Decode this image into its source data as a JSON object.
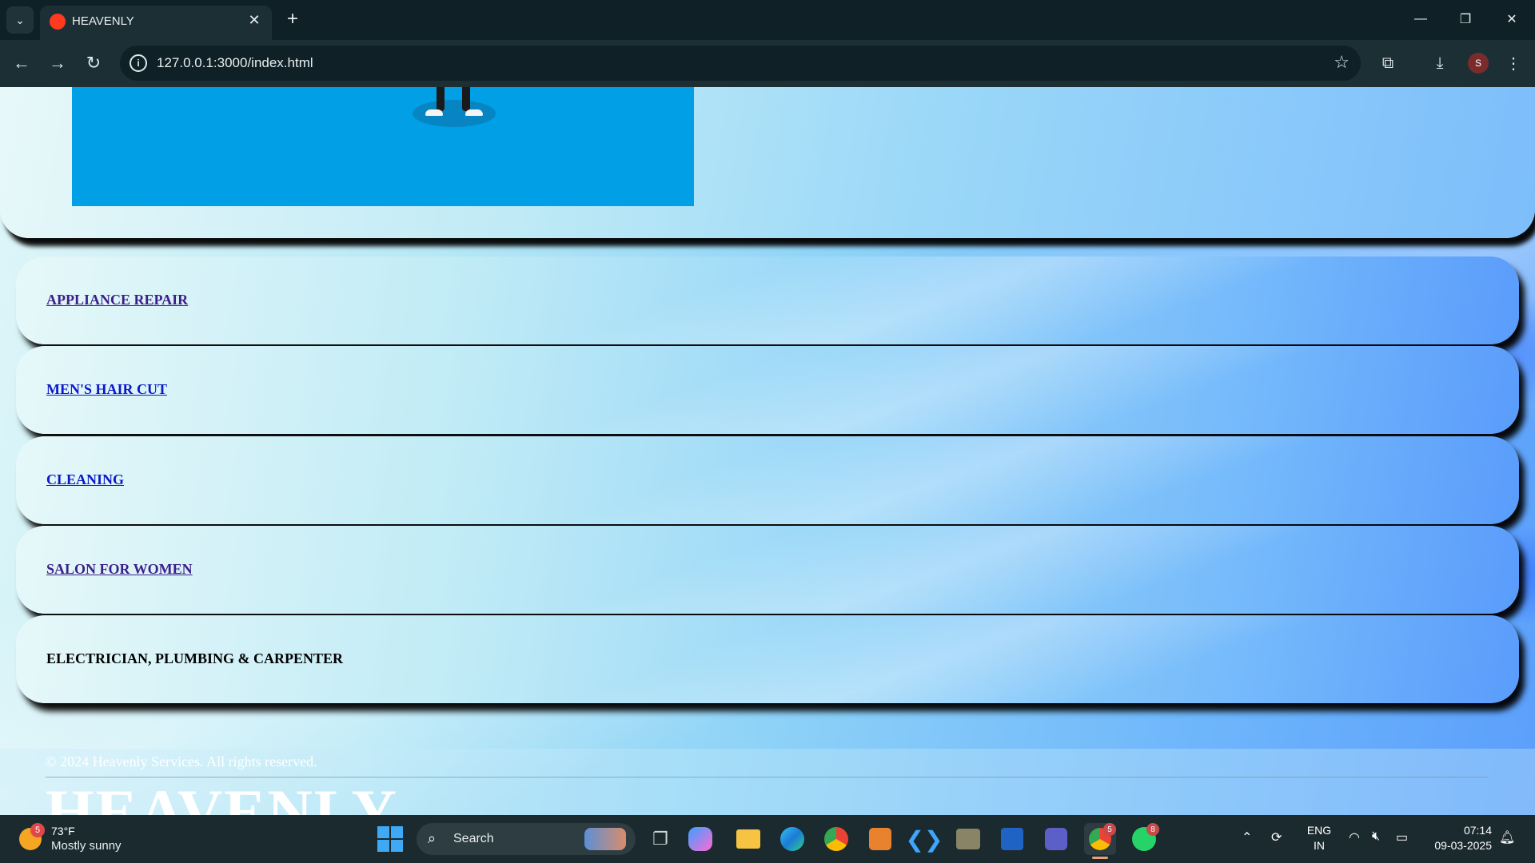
{
  "browser": {
    "tab_title": "HEAVENLY",
    "url": "127.0.0.1:3000/index.html",
    "profile_initial": "S"
  },
  "page": {
    "services": [
      {
        "label": "APPLIANCE REPAIR",
        "style": "visited"
      },
      {
        "label": "MEN'S HAIR CUT",
        "style": "link"
      },
      {
        "label": "CLEANING",
        "style": "link"
      },
      {
        "label": "SALON FOR WOMEN",
        "style": "visited"
      },
      {
        "label": "ELECTRICIAN, PLUMBING & CARPENTER",
        "style": "plain"
      }
    ],
    "footer": {
      "copyright": "© 2024 Heavenly Services. All rights reserved.",
      "brand": "HEAVENLY"
    }
  },
  "taskbar": {
    "weather": {
      "temp": "73°F",
      "desc": "Mostly sunny",
      "badge": "5"
    },
    "search_label": "Search",
    "chrome_badge": "5",
    "whatsapp_badge": "8",
    "language": {
      "line1": "ENG",
      "line2": "IN"
    },
    "time": "07:14",
    "date": "09-03-2025"
  }
}
